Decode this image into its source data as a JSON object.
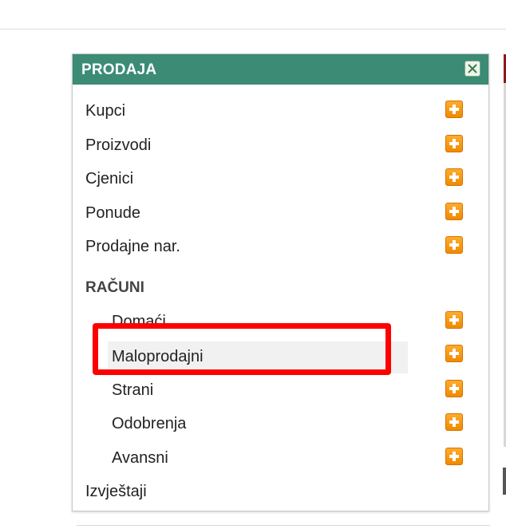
{
  "panel": {
    "title": "PRODAJA",
    "close_icon": "close-icon",
    "items": [
      {
        "label": "Kupci",
        "icon": "plus-icon"
      },
      {
        "label": "Proizvodi",
        "icon": "plus-icon"
      },
      {
        "label": "Cjenici",
        "icon": "plus-icon"
      },
      {
        "label": "Ponude",
        "icon": "plus-icon"
      },
      {
        "label": "Prodajne nar.",
        "icon": "plus-icon"
      }
    ],
    "section": {
      "heading": "RAČUNI",
      "items": [
        {
          "label": "Domaći",
          "icon": "plus-icon"
        },
        {
          "label": "Maloprodajni",
          "icon": "plus-icon"
        },
        {
          "label": "Strani",
          "icon": "plus-icon"
        },
        {
          "label": "Odobrenja",
          "icon": "plus-icon"
        },
        {
          "label": "Avansni",
          "icon": "plus-icon"
        }
      ]
    },
    "footer_item": {
      "label": "Izvještaji"
    }
  },
  "colors": {
    "header_bg": "#3b8b75",
    "plus_orange": "#f59a12",
    "highlight_border": "#ff0000"
  }
}
